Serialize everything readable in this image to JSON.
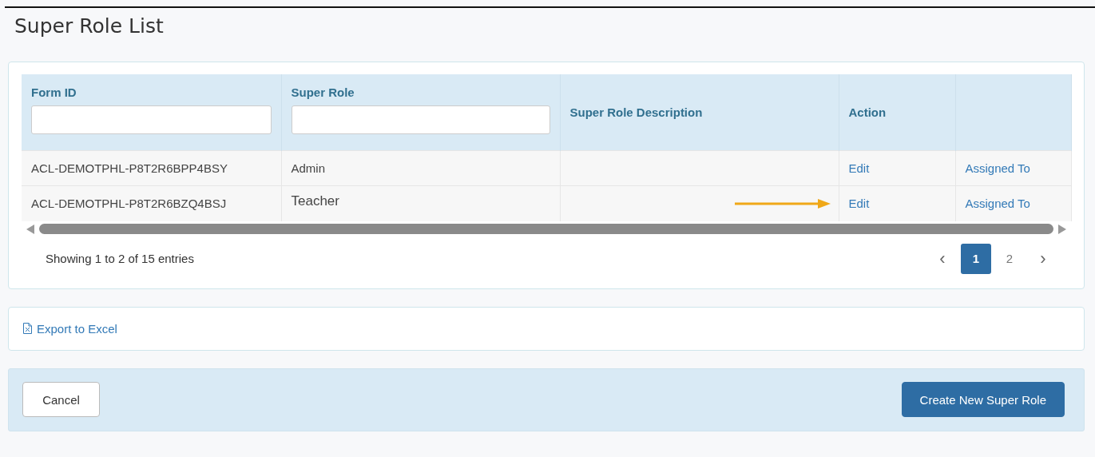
{
  "page": {
    "title": "Super Role List"
  },
  "table": {
    "columns": [
      {
        "label": "Form ID",
        "filter": true
      },
      {
        "label": "Super Role",
        "filter": true
      },
      {
        "label": "Super Role Description",
        "filter": false
      },
      {
        "label": "Action",
        "filter": false
      },
      {
        "filter": false
      }
    ],
    "rows": [
      {
        "form_id": "ACL-DEMOTPHL-P8T2R6BPP4BSY",
        "super_role": "Admin",
        "action": "Edit",
        "assigned": "Assigned To",
        "pointer_arrow": false
      },
      {
        "form_id": "ACL-DEMOTPHL-P8T2R6BZQ4BSJ",
        "super_role": "Teacher",
        "action": "Edit",
        "assigned": "Assigned To",
        "pointer_arrow": true
      }
    ]
  },
  "info": "Showing 1 to 2 of 15 entries",
  "pagination": {
    "prev": "‹",
    "next": "›",
    "pages": [
      {
        "label": "1",
        "selected": true
      },
      {
        "label": "2",
        "selected": false
      }
    ]
  },
  "export_link": "Export to Excel",
  "buttons": {
    "cancel": "Cancel",
    "create": "Create New Super Role"
  }
}
